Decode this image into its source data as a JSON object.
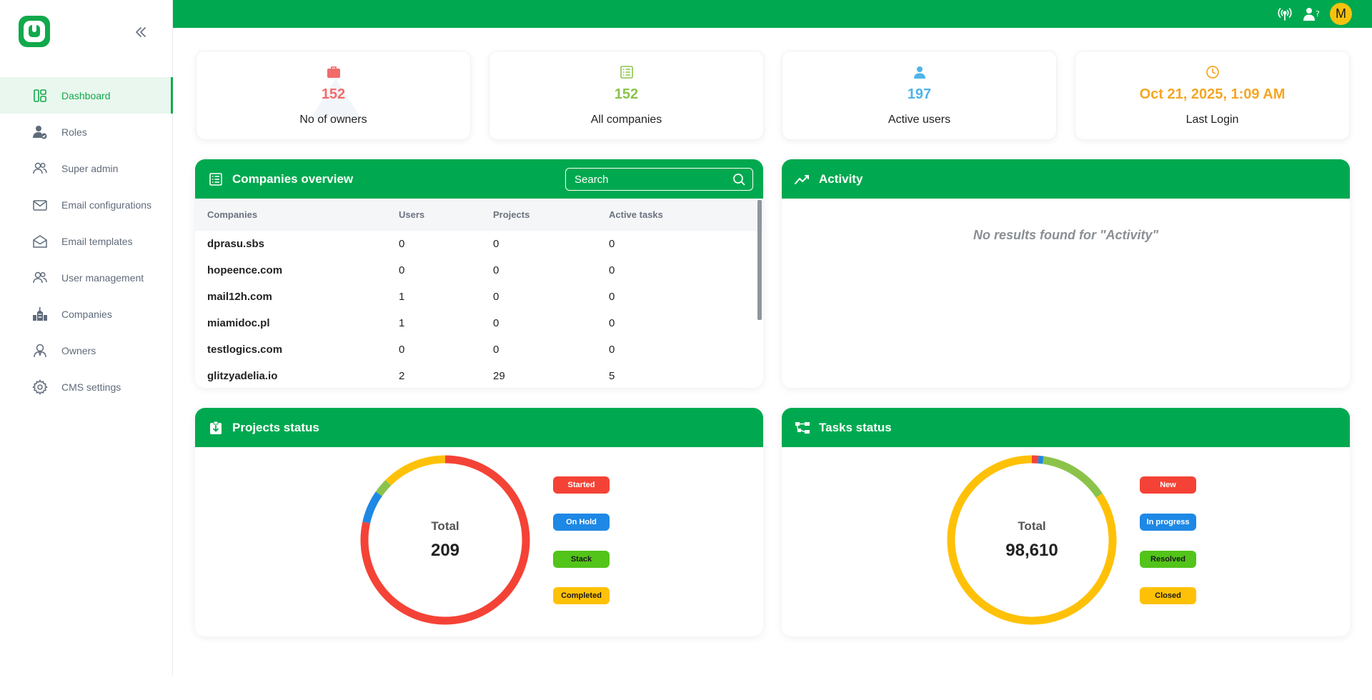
{
  "sidebar": {
    "items": [
      {
        "label": "Dashboard",
        "icon": "dashboard-icon",
        "active": true
      },
      {
        "label": "Roles",
        "icon": "role-user-icon",
        "active": false
      },
      {
        "label": "Super admin",
        "icon": "users-icon",
        "active": false
      },
      {
        "label": "Email configurations",
        "icon": "envelope-icon",
        "active": false
      },
      {
        "label": "Email templates",
        "icon": "envelope-open-icon",
        "active": false
      },
      {
        "label": "User management",
        "icon": "users-icon",
        "active": false
      },
      {
        "label": "Companies",
        "icon": "building-icon",
        "active": false
      },
      {
        "label": "Owners",
        "icon": "owner-icon",
        "active": false
      },
      {
        "label": "CMS settings",
        "icon": "gear-icon",
        "active": false
      }
    ]
  },
  "topbar": {
    "avatar_initial": "M"
  },
  "stats": [
    {
      "value": "152",
      "label": "No of owners",
      "color": "#f26b6b",
      "icon": "briefcase-icon"
    },
    {
      "value": "152",
      "label": "All companies",
      "color": "#8bc34a",
      "icon": "list-icon"
    },
    {
      "value": "197",
      "label": "Active users",
      "color": "#4fb3e8",
      "icon": "user-icon"
    },
    {
      "value": "Oct 21, 2025, 1:09 AM",
      "label": "Last Login",
      "color": "#f5a623",
      "icon": "clock-icon"
    }
  ],
  "companies_overview": {
    "title": "Companies overview",
    "search_placeholder": "Search",
    "columns": [
      "Companies",
      "Users",
      "Projects",
      "Active tasks"
    ],
    "rows": [
      [
        "dprasu.sbs",
        "0",
        "0",
        "0"
      ],
      [
        "hopeence.com",
        "0",
        "0",
        "0"
      ],
      [
        "mail12h.com",
        "1",
        "0",
        "0"
      ],
      [
        "miamidoc.pl",
        "1",
        "0",
        "0"
      ],
      [
        "testlogics.com",
        "0",
        "0",
        "0"
      ],
      [
        "glitzyadelia.io",
        "2",
        "29",
        "5"
      ]
    ]
  },
  "activity": {
    "title": "Activity",
    "empty_text": "No results found for \"Activity\""
  },
  "projects_status": {
    "title": "Projects status",
    "total_label": "Total",
    "total_value": "209",
    "legend": [
      {
        "label": "Started",
        "color": "#f44336"
      },
      {
        "label": "On Hold",
        "color": "#1e88e5"
      },
      {
        "label": "Stack",
        "color": "#52c41a"
      },
      {
        "label": "Completed",
        "color": "#ffc107"
      }
    ]
  },
  "tasks_status": {
    "title": "Tasks status",
    "total_label": "Total",
    "total_value": "98,610",
    "legend": [
      {
        "label": "New",
        "color": "#f44336"
      },
      {
        "label": "In progress",
        "color": "#1e88e5"
      },
      {
        "label": "Resolved",
        "color": "#52c41a"
      },
      {
        "label": "Closed",
        "color": "#ffc107"
      }
    ]
  },
  "chart_data": [
    {
      "type": "pie",
      "categories": [
        "Started",
        "On Hold",
        "Stack",
        "Completed"
      ],
      "values": [
        164,
        13,
        6,
        26
      ],
      "colors": [
        "#f44336",
        "#1e88e5",
        "#8bc34a",
        "#ffc107"
      ],
      "title": "Projects status"
    },
    {
      "type": "pie",
      "categories": [
        "New",
        "In progress",
        "Resolved",
        "Closed"
      ],
      "values": [
        1250,
        950,
        13300,
        83110
      ],
      "colors": [
        "#f44336",
        "#1e88e5",
        "#8bc34a",
        "#ffc107"
      ],
      "title": "Tasks status"
    }
  ]
}
